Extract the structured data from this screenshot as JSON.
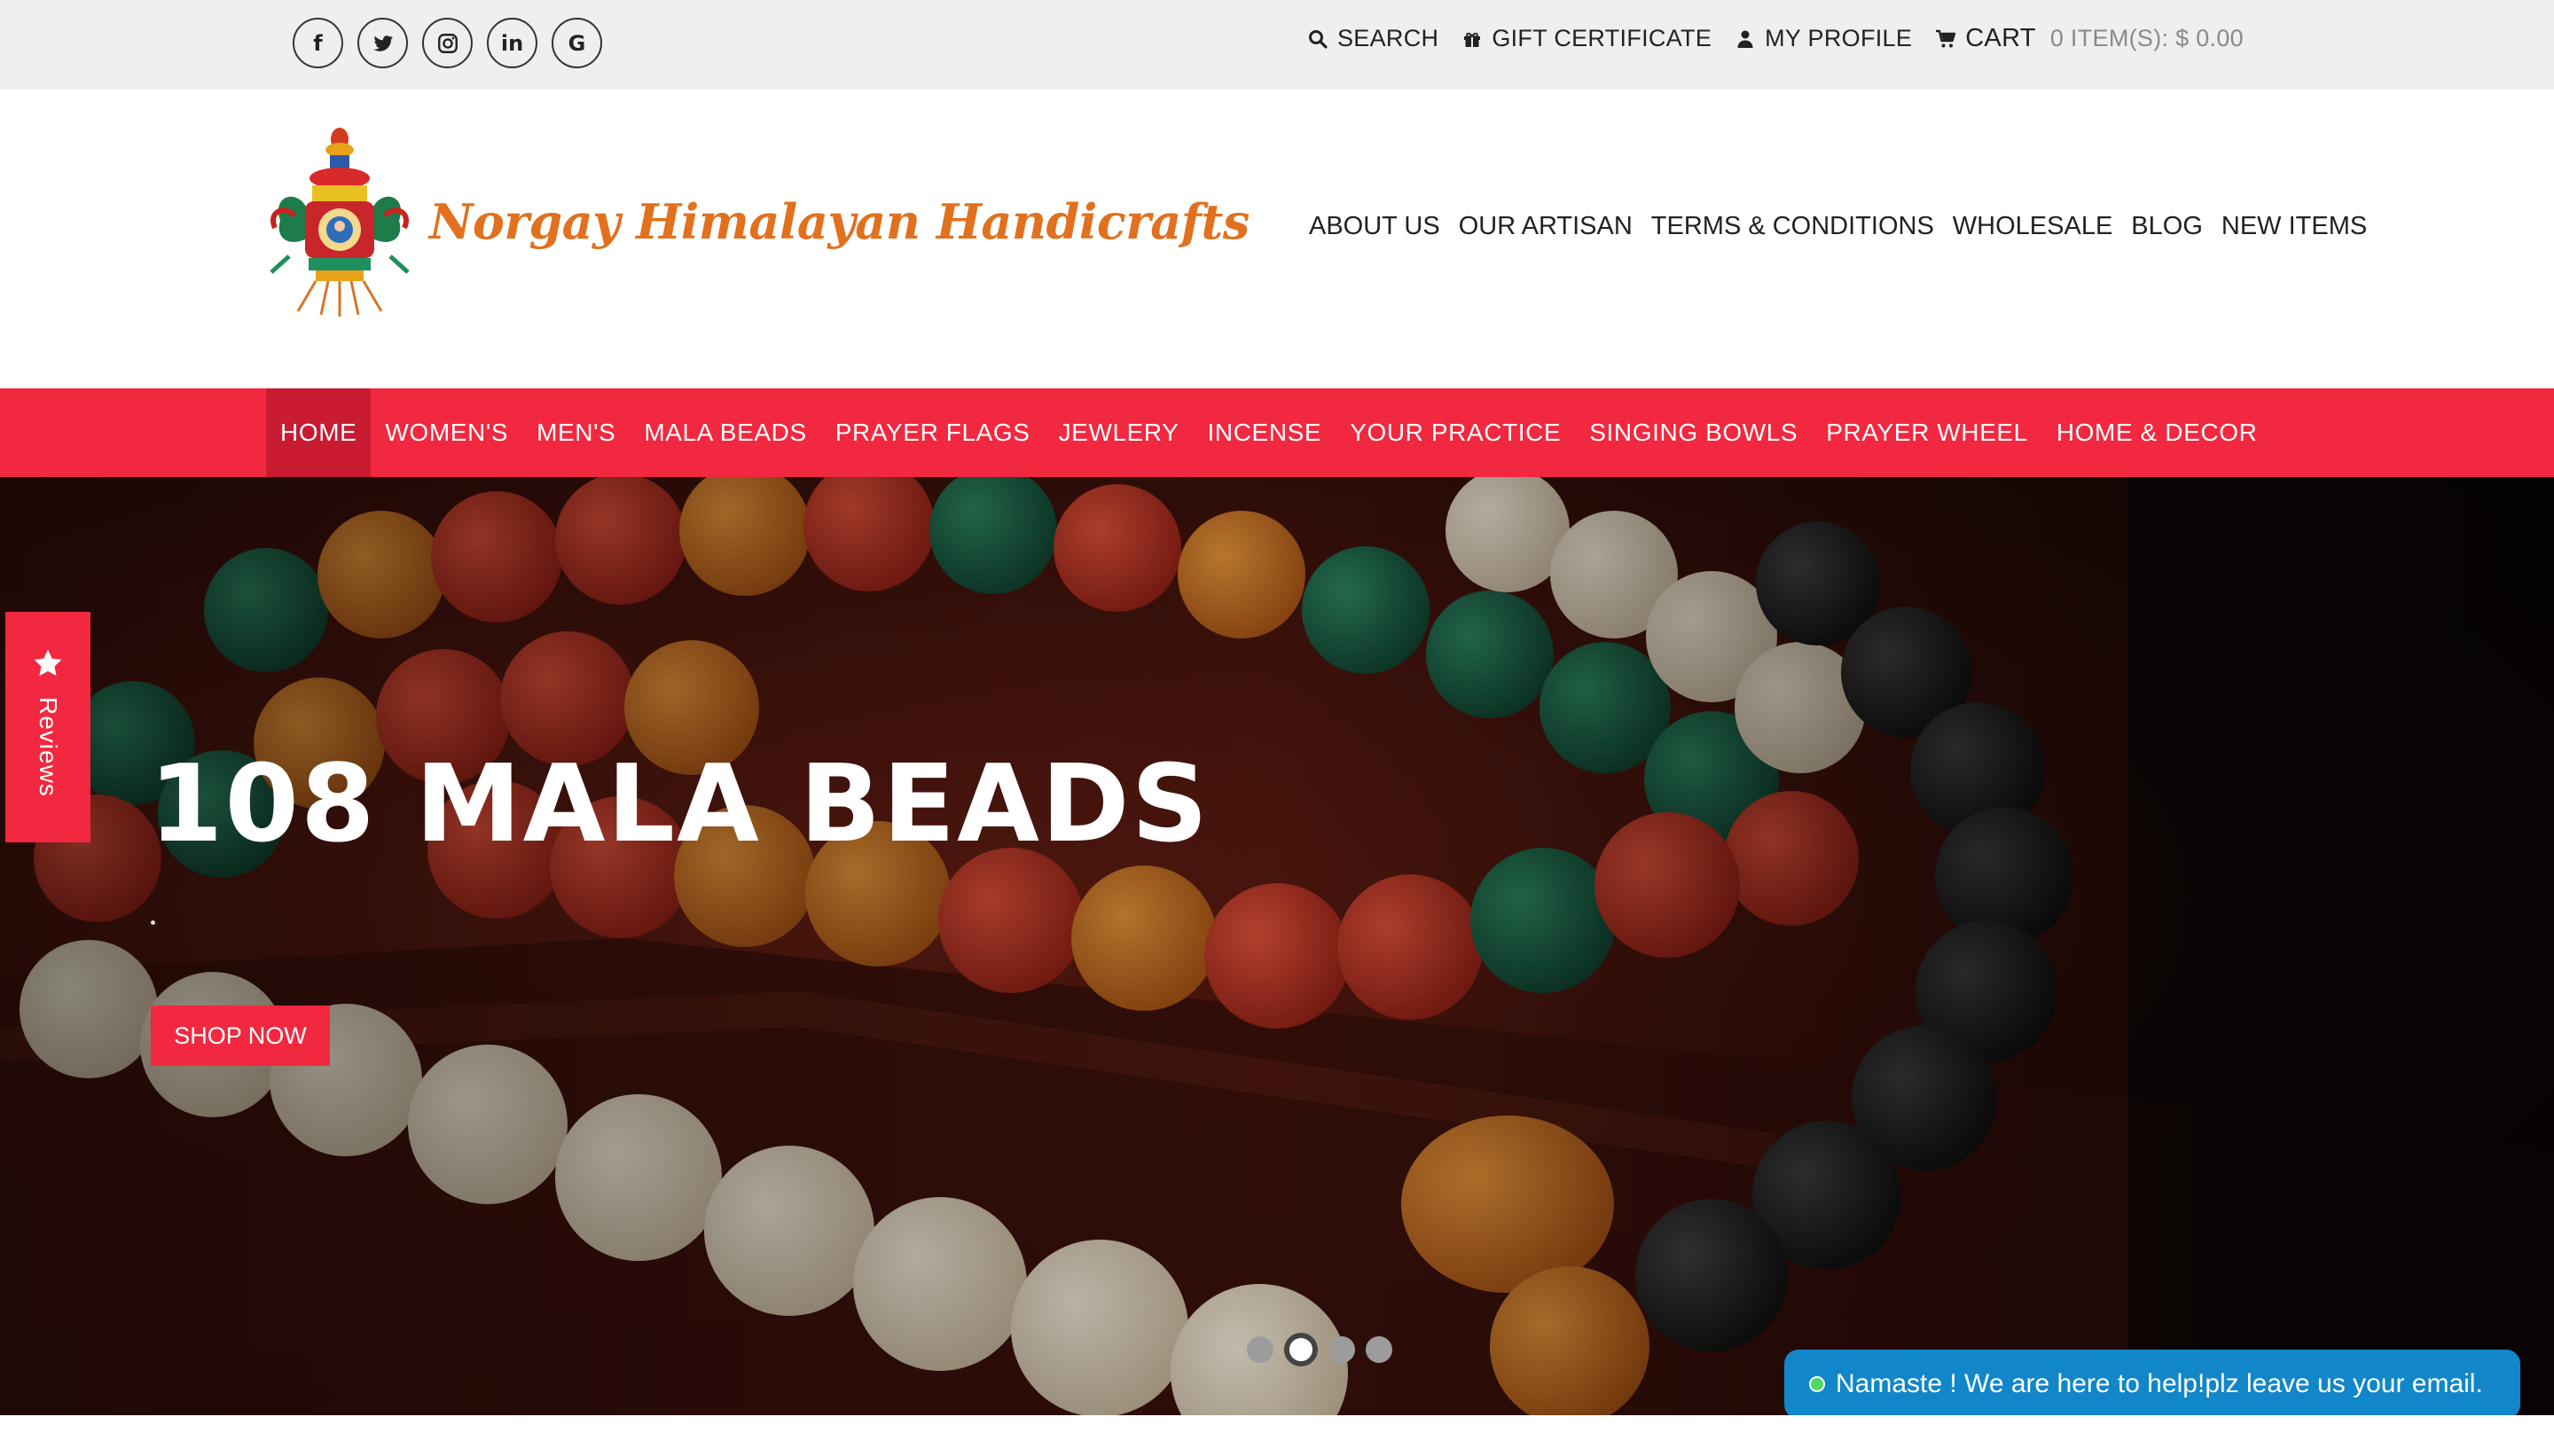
{
  "topbar": {
    "social": [
      {
        "name": "facebook-icon",
        "glyph": "f"
      },
      {
        "name": "twitter-icon",
        "glyph": ""
      },
      {
        "name": "instagram-icon",
        "glyph": ""
      },
      {
        "name": "linkedin-icon",
        "glyph": "in"
      },
      {
        "name": "google-icon",
        "glyph": "G"
      }
    ],
    "search_label": "SEARCH",
    "gift_label": "GIFT CERTIFICATE",
    "profile_label": "MY PROFILE",
    "cart_label": "CART",
    "cart_info": "0 ITEM(S): $ 0.00"
  },
  "header": {
    "logo_text": "Norgay Himalayan Handicrafts",
    "secondary_nav": [
      "ABOUT US",
      "OUR ARTISAN",
      "TERMS & CONDITIONS",
      "WHOLESALE",
      "BLOG",
      "NEW ITEMS"
    ]
  },
  "main_nav": {
    "items": [
      "HOME",
      "WOMEN'S",
      "MEN'S",
      "MALA BEADS",
      "PRAYER FLAGS",
      "JEWLERY",
      "INCENSE",
      "YOUR PRACTICE",
      "SINGING BOWLS",
      "PRAYER WHEEL",
      "HOME & DECOR"
    ],
    "active": "HOME"
  },
  "hero": {
    "title": "108 MALA BEADS",
    "button_label": "SHOP NOW",
    "slides_count": 4,
    "active_slide": 2
  },
  "reviews_tab": {
    "label": "Reviews"
  },
  "chat": {
    "message": "Namaste ! We are here to help!plz leave us your email."
  },
  "colors": {
    "brand_red": "#f1283f",
    "active_nav": "#c81b31",
    "logo_orange": "#e1711e",
    "chat_blue": "#1186c9",
    "topbar_bg": "#efefef"
  }
}
